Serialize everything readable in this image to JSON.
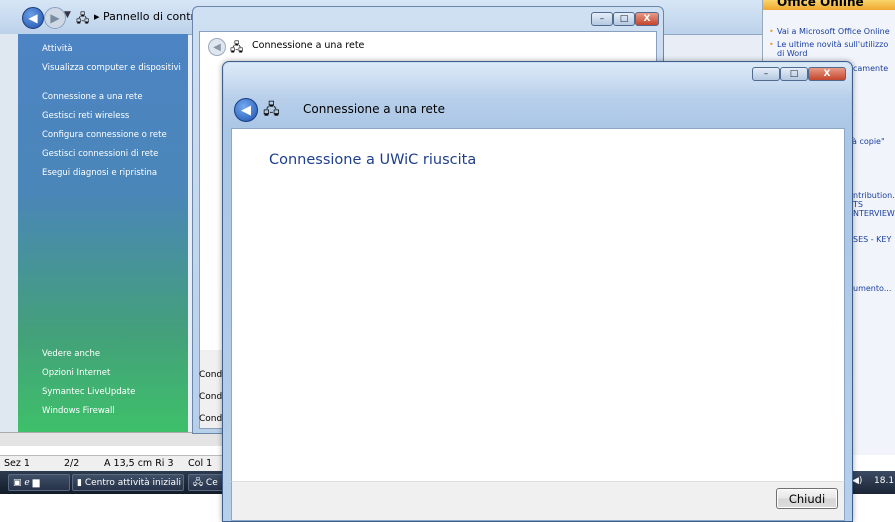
{
  "control_panel": {
    "breadcrumb": "Pannello di controllo",
    "sidebar": {
      "section_title": "Attività",
      "tasks": [
        "Visualizza computer e dispositivi",
        "Connessione a una rete",
        "Gestisci reti wireless",
        "Configura connessione o rete",
        "Gestisci connessioni di rete",
        "Esegui diagnosi e ripristina"
      ],
      "see_also_title": "Vedere anche",
      "see_also": [
        "Opzioni Internet",
        "Symantec LiveUpdate",
        "Windows Firewall"
      ]
    },
    "partial_labels": [
      "Condiv",
      "Condiv",
      "Condiv"
    ]
  },
  "back_dialog": {
    "title": "Connessione a una rete"
  },
  "dialog": {
    "title": "Connessione a una rete",
    "heading": "Connessione a UWiC riuscita",
    "close_button": "Chiudi",
    "controls": {
      "minimize": "–",
      "maximize": "□",
      "close": "X"
    }
  },
  "office_panel": {
    "header": "Office Online",
    "bullets": [
      "Vai a Microsoft Office Online",
      "Le ultime novità sull'utilizzo di Word"
    ],
    "snippets": [
      "camente",
      "à copie\"",
      "ntribution.",
      "TS",
      "NTERVIEW @",
      "SES - KEY",
      "umento..."
    ]
  },
  "word_status": {
    "section": "Sez 1",
    "pages": "2/2",
    "position": "A 13,5 cm  Ri 3",
    "column": "Col 1"
  },
  "taskbar": {
    "buttons": [
      "Centro attività iniziali",
      "Ce"
    ],
    "clock": "18.1"
  },
  "colors": {
    "dialog_heading": "#1e3f8c",
    "sidebar_top": "#4d84c4",
    "sidebar_bottom": "#3ec06a"
  }
}
